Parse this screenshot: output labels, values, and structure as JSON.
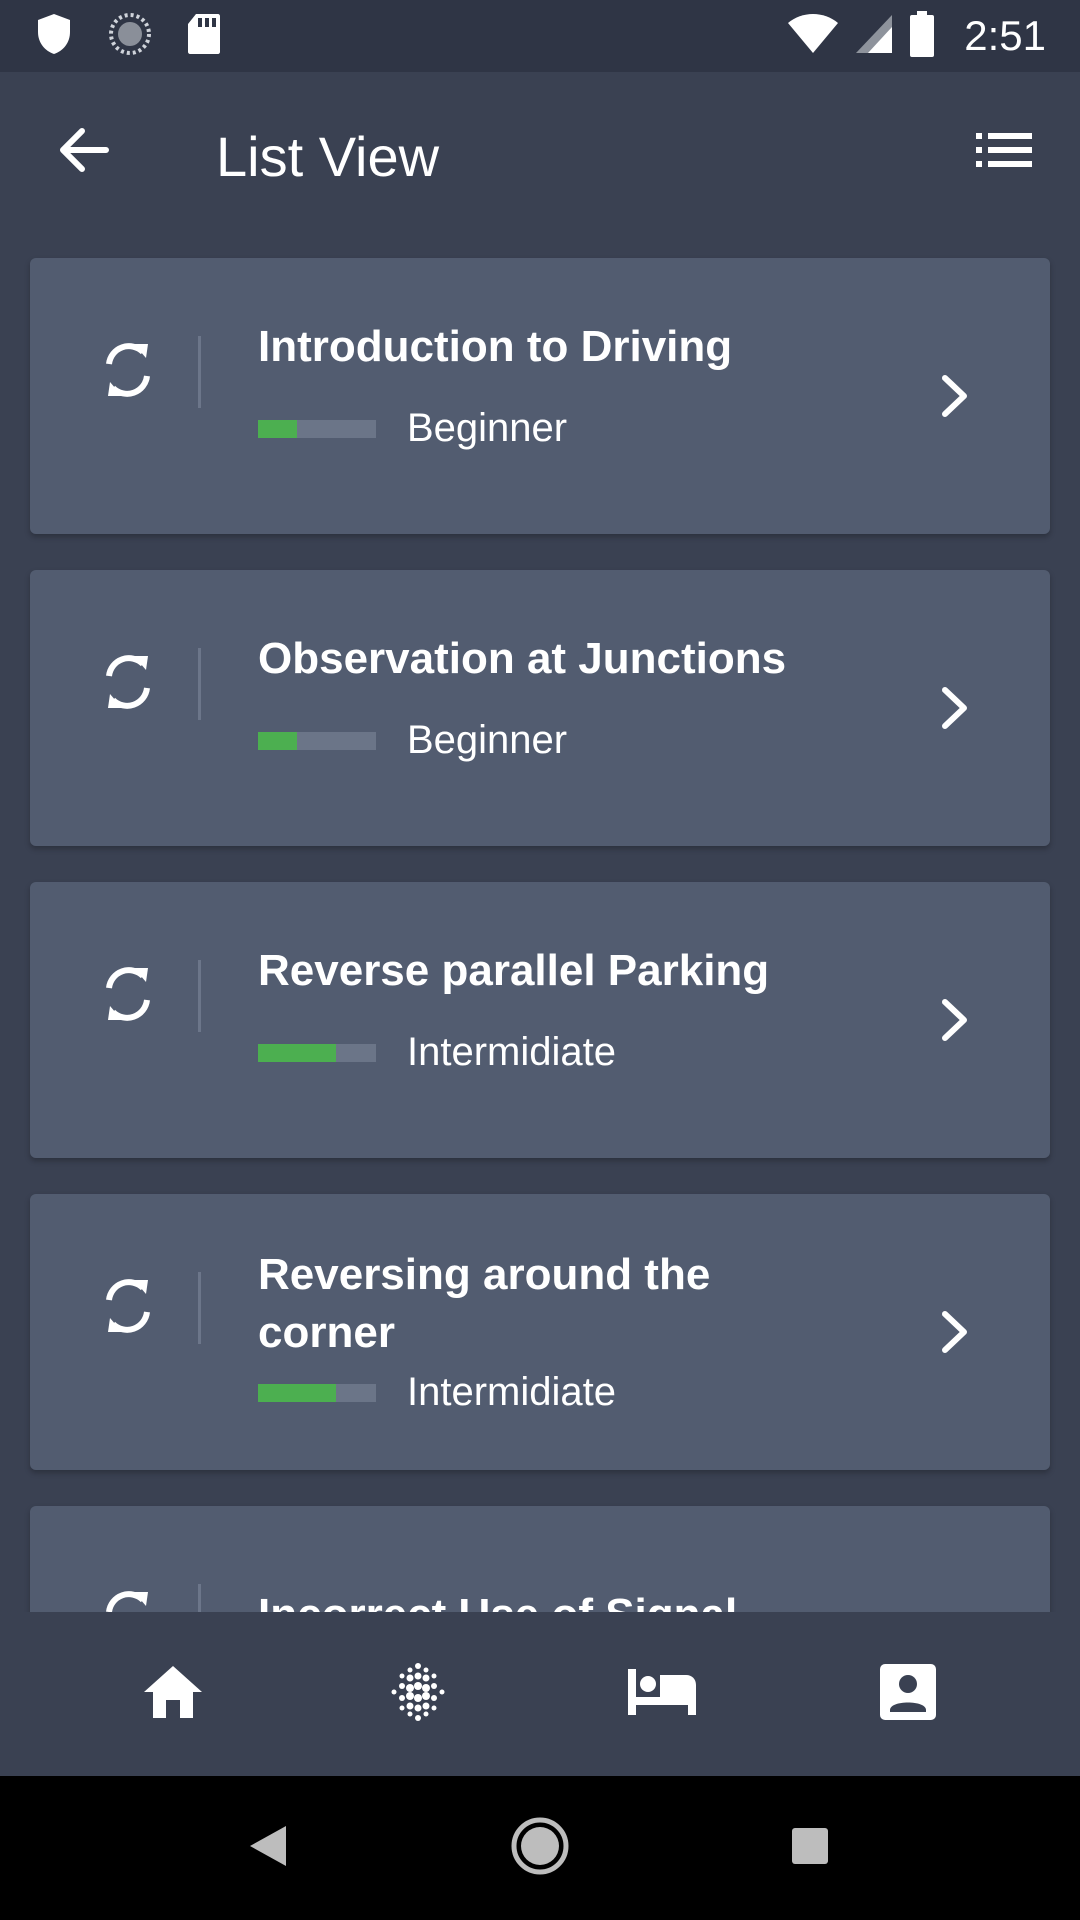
{
  "status_bar": {
    "time": "2:51",
    "icons": [
      "shield-icon",
      "loading-circle-icon",
      "sd-card-icon",
      "wifi-icon",
      "cell-signal-icon",
      "battery-icon"
    ]
  },
  "app_bar": {
    "title": "List View",
    "back_icon": "arrow-left-icon",
    "menu_icon": "list-icon"
  },
  "lessons": [
    {
      "title": "Introduction to Driving",
      "level": "Beginner",
      "progress": 0.33
    },
    {
      "title": "Observation at Junctions",
      "level": "Beginner",
      "progress": 0.33
    },
    {
      "title": "Reverse parallel Parking",
      "level": "Intermidiate",
      "progress": 0.66
    },
    {
      "title": "Reversing around the corner",
      "level": "Intermidiate",
      "progress": 0.66
    },
    {
      "title": "Incorrect Use of Signal",
      "level": "",
      "progress": 0
    }
  ],
  "colors": {
    "background": "#3a4152",
    "card": "#525c70",
    "status_bar": "#2f3545",
    "progress_fill": "#4caf50",
    "progress_track": "#6b7588"
  },
  "bottom_nav": {
    "items": [
      "home-icon",
      "dots-grid-icon",
      "bed-icon",
      "contact-card-icon"
    ]
  },
  "system_nav": {
    "items": [
      "back-triangle-icon",
      "home-circle-icon",
      "recents-square-icon"
    ]
  }
}
